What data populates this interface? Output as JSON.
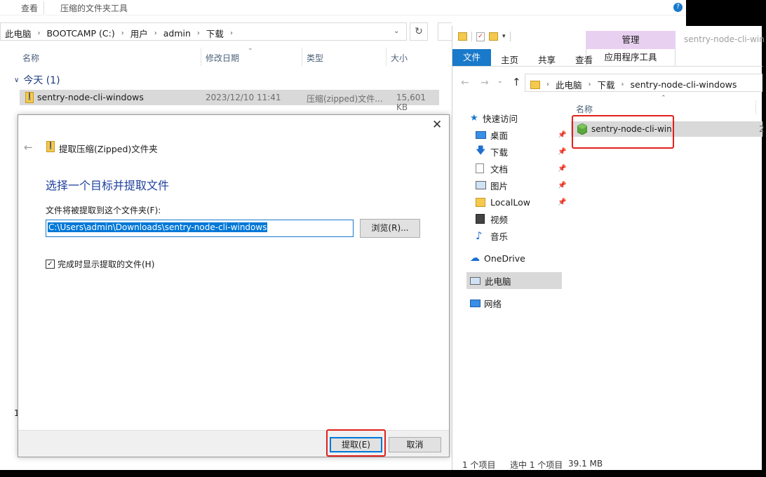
{
  "left_window": {
    "tabs": [
      "查看",
      "压缩的文件夹工具"
    ],
    "address": [
      "此电脑",
      "BOOTCAMP (C:)",
      "用户",
      "admin",
      "下载"
    ],
    "columns": [
      "名称",
      "修改日期",
      "类型",
      "大小"
    ],
    "group_label": "今天 (1)",
    "file": {
      "name": "sentry-node-cli-windows",
      "date": "2023/12/10 11:41",
      "type": "压缩(zipped)文件...",
      "size": "15,601 KB"
    },
    "status_count": "1"
  },
  "dialog": {
    "title": "提取压缩(Zipped)文件夹",
    "heading": "选择一个目标并提取文件",
    "path_label": "文件将被提取到这个文件夹(F):",
    "path_value": "C:\\Users\\admin\\Downloads\\sentry-node-cli-windows",
    "browse_label": "浏览(R)...",
    "checkbox_label": "完成时显示提取的文件(H)",
    "checkbox_checked": true,
    "extract_label": "提取(E)",
    "cancel_label": "取消"
  },
  "right_window": {
    "manage_tab": "管理",
    "title_text": "sentry-node-cli-win",
    "ribbon_tabs": [
      "文件",
      "主页",
      "共享",
      "查看"
    ],
    "context_tab": "应用程序工具",
    "address": [
      "此电脑",
      "下载",
      "sentry-node-cli-windows"
    ],
    "column_name": "名称",
    "file_name": "sentry-node-cli-win",
    "file_trailing": "2",
    "quick_access_label": "快速访问",
    "nav_items": [
      {
        "label": "桌面",
        "icon": "desktop-icon"
      },
      {
        "label": "下载",
        "icon": "download-icon"
      },
      {
        "label": "文档",
        "icon": "document-icon"
      },
      {
        "label": "图片",
        "icon": "picture-icon"
      },
      {
        "label": "LocalLow",
        "icon": "folder-icon"
      },
      {
        "label": "视频",
        "icon": "video-icon"
      },
      {
        "label": "音乐",
        "icon": "music-icon"
      }
    ],
    "onedrive_label": "OneDrive",
    "this_pc_label": "此电脑",
    "network_label": "网络",
    "status": {
      "count": "1 个项目",
      "selected": "选中 1 个项目",
      "size": "39.1 MB"
    }
  },
  "colors": {
    "accent_blue": "#1979ca",
    "highlight_red": "#e0201c",
    "manage_tab": "#e8d1f0",
    "selection_gray": "#d9d9d9",
    "heading_blue": "#1f3f9c"
  }
}
